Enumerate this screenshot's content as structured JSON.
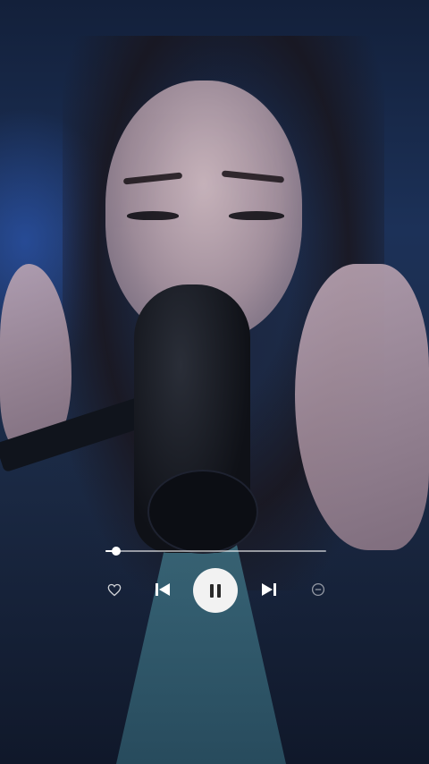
{
  "player": {
    "progress_fraction": 0.05,
    "controls": [
      {
        "name": "like-button",
        "icon": "heart-icon"
      },
      {
        "name": "previous-button",
        "icon": "skip-previous-icon"
      },
      {
        "name": "pause-button",
        "icon": "pause-icon"
      },
      {
        "name": "next-button",
        "icon": "skip-next-icon"
      },
      {
        "name": "remove-button",
        "icon": "minus-circle-icon"
      }
    ]
  },
  "colors": {
    "accent": "#ffffff",
    "play_button_bg": "#f2f2f2"
  }
}
